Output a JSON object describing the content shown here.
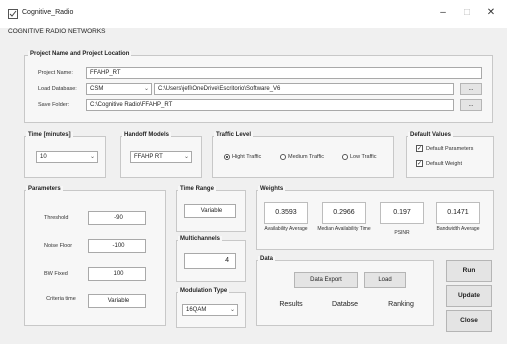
{
  "window": {
    "title": "Cognitive_Radio",
    "subtitle": "COGNITIVE RADIO NETWORKS",
    "minimize": "–",
    "maximize": "□",
    "close": "✕"
  },
  "project": {
    "title": "Project Name and Project Location",
    "name_label": "Project Name:",
    "name_value": "FFAHP_RT",
    "db_label": "Load Database:",
    "db_select": "CSM",
    "db_path": "C:\\Users\\jefi\\OneDrive\\Escritorio\\Software_V6",
    "save_label": "Save Folder:",
    "save_path": "C:\\Cognitive Radio\\FFAHP_RT",
    "browse": "..."
  },
  "time": {
    "title": "Time [minutes]",
    "value": "10"
  },
  "handoff": {
    "title": "Handoff Models",
    "value": "FFAHP RT"
  },
  "traffic": {
    "title": "Traffic Level",
    "options": [
      "Hight Traffic",
      "Medium Traffic",
      "Low Traffic"
    ],
    "selected": "Hight Traffic"
  },
  "defaults": {
    "title": "Default Values",
    "params": "Default Parameters",
    "weight": "Default Weight"
  },
  "parameters": {
    "title": "Parameters",
    "rows": [
      {
        "label": "Threshold",
        "value": "-90"
      },
      {
        "label": "Noise Floor",
        "value": "-100"
      },
      {
        "label": "BW Fixed",
        "value": "100"
      },
      {
        "label": "Criteria time",
        "value": "Variable"
      }
    ]
  },
  "time_range": {
    "title": "Time Range",
    "value": "Variable"
  },
  "multichannels": {
    "title": "Multichannels",
    "value": "4"
  },
  "modulation": {
    "title": "Modulation Type",
    "value": "16QAM"
  },
  "weights": {
    "title": "Weights",
    "items": [
      {
        "value": "0.3593",
        "label": "Availability Average"
      },
      {
        "value": "0.2966",
        "label": "Median Availability Time"
      },
      {
        "value": "0.197",
        "label": "PSINR"
      },
      {
        "value": "0.1471",
        "label": "Bandwidth Average"
      }
    ]
  },
  "data": {
    "title": "Data",
    "export": "Data Export",
    "load": "Load",
    "results": "Results",
    "database": "Databse",
    "ranking": "Ranking"
  },
  "actions": {
    "run": "Run",
    "update": "Update",
    "close": "Close"
  }
}
